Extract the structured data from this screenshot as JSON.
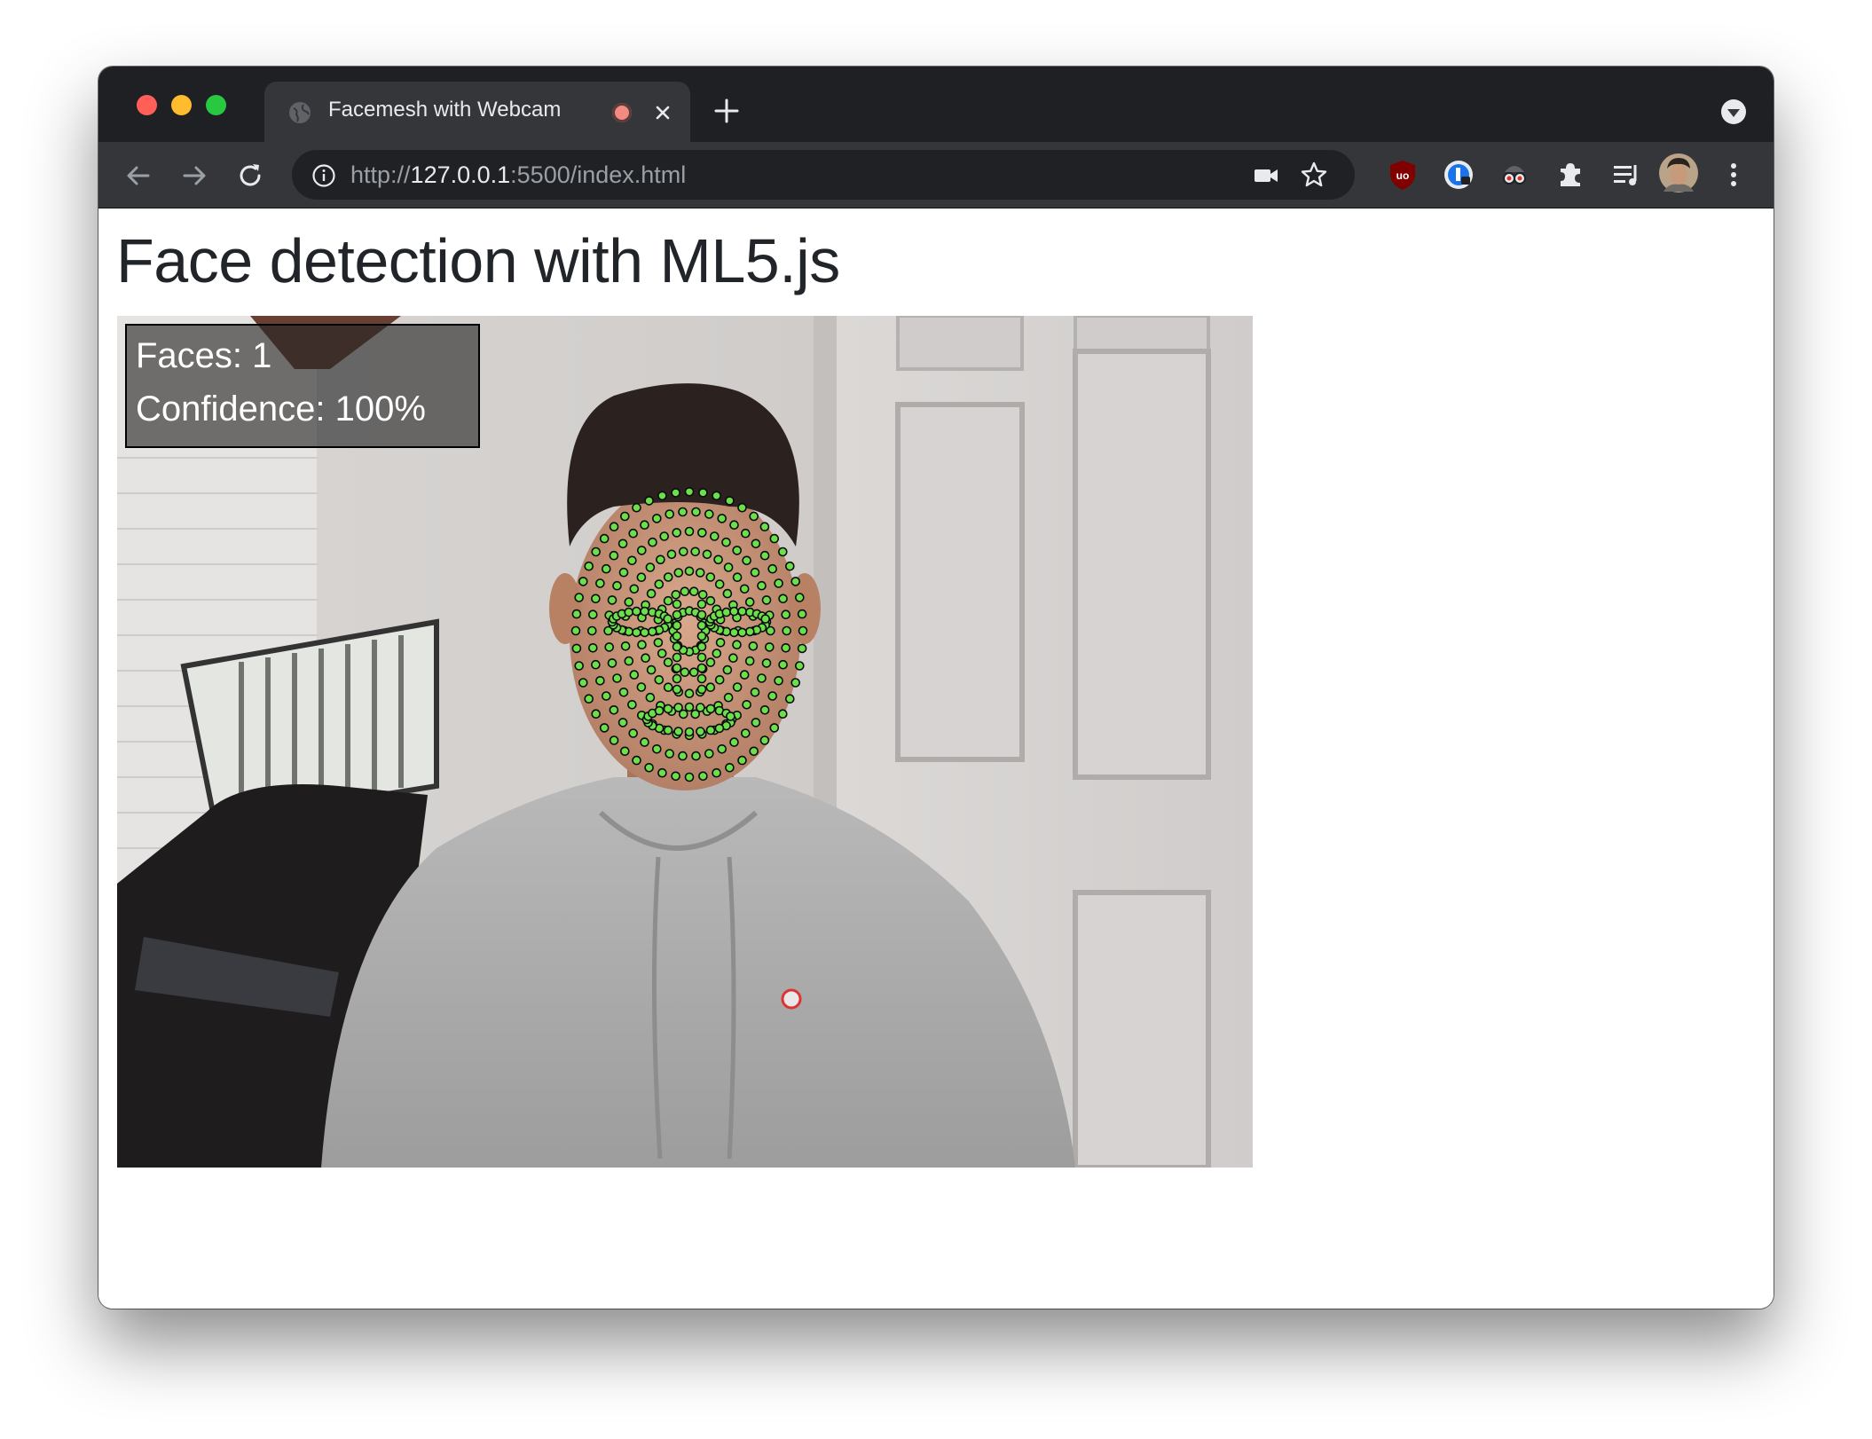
{
  "browser": {
    "tab": {
      "title": "Facemesh with Webcam"
    },
    "omnibox": {
      "url_scheme": "http://",
      "url_host": "127.0.0.1",
      "url_rest": ":5500/index.html"
    }
  },
  "page": {
    "title": "Face detection with ML5.js",
    "overlay": {
      "faces_line": "Faces: 1",
      "confidence_line": "Confidence: 100%"
    },
    "detection": {
      "faces": 1,
      "confidence_percent": 100,
      "landmark_color": "#6be04a"
    }
  },
  "icons": {
    "tab": [
      "globe-icon",
      "recording-icon",
      "close-icon",
      "plus-icon",
      "tab-search-icon"
    ],
    "toolbar": [
      "back-arrow-icon",
      "forward-arrow-icon",
      "reload-icon",
      "info-icon",
      "camera-icon",
      "star-icon",
      "ublock-icon",
      "password-manager-icon",
      "spy-icon",
      "puzzle-icon",
      "reading-list-icon",
      "profile-avatar",
      "kebab-menu-icon"
    ]
  },
  "colors": {
    "window_dark": "#1f2023",
    "tab_active": "#35363a",
    "omnibox": "#202124",
    "text_light": "#e8eaed",
    "text_dim": "#9aa0a6"
  }
}
